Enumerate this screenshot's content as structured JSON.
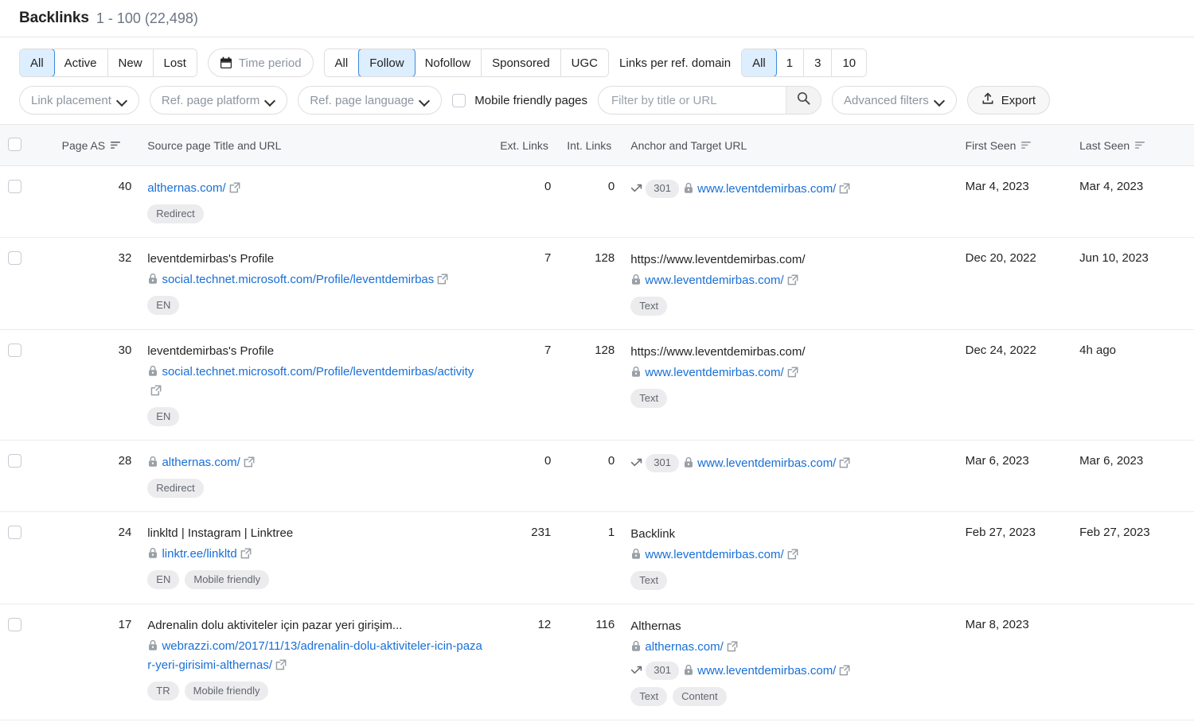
{
  "header": {
    "title": "Backlinks",
    "count_range": "1 - 100 (22,498)"
  },
  "toolbar": {
    "status_group": {
      "options": [
        "All",
        "Active",
        "New",
        "Lost"
      ],
      "selected": "All"
    },
    "time_period": {
      "label": "Time period",
      "icon": "calendar-icon"
    },
    "follow_group": {
      "options": [
        "All",
        "Follow",
        "Nofollow",
        "Sponsored",
        "UGC"
      ],
      "selected": "Follow"
    },
    "links_per_domain": {
      "label": "Links per ref. domain",
      "options": [
        "All",
        "1",
        "3",
        "10"
      ],
      "selected": "All"
    },
    "link_placement": {
      "label": "Link placement",
      "icon": "chevron-down-icon"
    },
    "ref_page_platform": {
      "label": "Ref. page platform",
      "icon": "chevron-down-icon"
    },
    "ref_page_language": {
      "label": "Ref. page language",
      "icon": "chevron-down-icon"
    },
    "mobile_friendly": {
      "label": "Mobile friendly pages",
      "checked": false
    },
    "search": {
      "placeholder": "Filter by title or URL",
      "value": "",
      "icon": "search-icon"
    },
    "advanced_filters": {
      "label": "Advanced filters",
      "icon": "chevron-down-icon"
    },
    "export": {
      "label": "Export",
      "icon": "upload-icon"
    }
  },
  "table": {
    "columns": {
      "page_as": "Page AS",
      "source": "Source page Title and URL",
      "ext_links": "Ext. Links",
      "int_links": "Int. Links",
      "anchor": "Anchor and Target URL",
      "first_seen": "First Seen",
      "last_seen": "Last Seen"
    },
    "rows": [
      {
        "page_as": "40",
        "source": {
          "title": "",
          "has_lock": false,
          "url": "althernas.com/",
          "tags": [
            "Redirect"
          ]
        },
        "ext_links": "0",
        "int_links": "0",
        "anchor": {
          "text": "",
          "redirect_code": "301",
          "target_has_lock": true,
          "target_url": "www.leventdemirbas.com/",
          "tags": []
        },
        "first_seen": "Mar 4, 2023",
        "last_seen": "Mar 4, 2023"
      },
      {
        "page_as": "32",
        "source": {
          "title": "leventdemirbas's Profile",
          "has_lock": true,
          "url": "social.technet.microsoft.com/Profile/leventdemirbas",
          "tags": [
            "EN"
          ]
        },
        "ext_links": "7",
        "int_links": "128",
        "anchor": {
          "text": "https://www.leventdemirbas.com/",
          "redirect_code": "",
          "target_has_lock": true,
          "target_url": "www.leventdemirbas.com/",
          "tags": [
            "Text"
          ]
        },
        "first_seen": "Dec 20, 2022",
        "last_seen": "Jun 10, 2023"
      },
      {
        "page_as": "30",
        "source": {
          "title": "leventdemirbas's Profile",
          "has_lock": true,
          "url": "social.technet.microsoft.com/Profile/leventdemirbas/activity",
          "tags": [
            "EN"
          ]
        },
        "ext_links": "7",
        "int_links": "128",
        "anchor": {
          "text": "https://www.leventdemirbas.com/",
          "redirect_code": "",
          "target_has_lock": true,
          "target_url": "www.leventdemirbas.com/",
          "tags": [
            "Text"
          ]
        },
        "first_seen": "Dec 24, 2022",
        "last_seen": "4h ago"
      },
      {
        "page_as": "28",
        "source": {
          "title": "",
          "has_lock": true,
          "url": "althernas.com/",
          "tags": [
            "Redirect"
          ]
        },
        "ext_links": "0",
        "int_links": "0",
        "anchor": {
          "text": "",
          "redirect_code": "301",
          "target_has_lock": true,
          "target_url": "www.leventdemirbas.com/",
          "tags": []
        },
        "first_seen": "Mar 6, 2023",
        "last_seen": "Mar 6, 2023"
      },
      {
        "page_as": "24",
        "source": {
          "title": "linkltd | Instagram | Linktree",
          "has_lock": true,
          "url": "linktr.ee/linkltd",
          "tags": [
            "EN",
            "Mobile friendly"
          ]
        },
        "ext_links": "231",
        "int_links": "1",
        "anchor": {
          "text": "Backlink",
          "redirect_code": "",
          "target_has_lock": true,
          "target_url": "www.leventdemirbas.com/",
          "tags": [
            "Text"
          ]
        },
        "first_seen": "Feb 27, 2023",
        "last_seen": "Feb 27, 2023"
      },
      {
        "page_as": "17",
        "source": {
          "title": "Adrenalin dolu aktiviteler için pazar yeri girişim...",
          "has_lock": true,
          "url": "webrazzi.com/2017/11/13/adrenalin-dolu-aktiviteler-icin-pazar-yeri-girisimi-althernas/",
          "tags": [
            "TR",
            "Mobile friendly"
          ]
        },
        "ext_links": "12",
        "int_links": "116",
        "anchor": {
          "text": "Althernas",
          "intermediate_has_lock": true,
          "intermediate_url": "althernas.com/",
          "redirect_code": "301",
          "target_has_lock": true,
          "target_url": "www.leventdemirbas.com/",
          "tags": [
            "Text",
            "Content"
          ]
        },
        "first_seen": "Mar 8, 2023",
        "last_seen": ""
      }
    ]
  },
  "colors": {
    "link": "#186fd7",
    "accent": "#3c8ae0",
    "accent_bg": "#ddeeff",
    "tag_bg": "#ececee"
  }
}
